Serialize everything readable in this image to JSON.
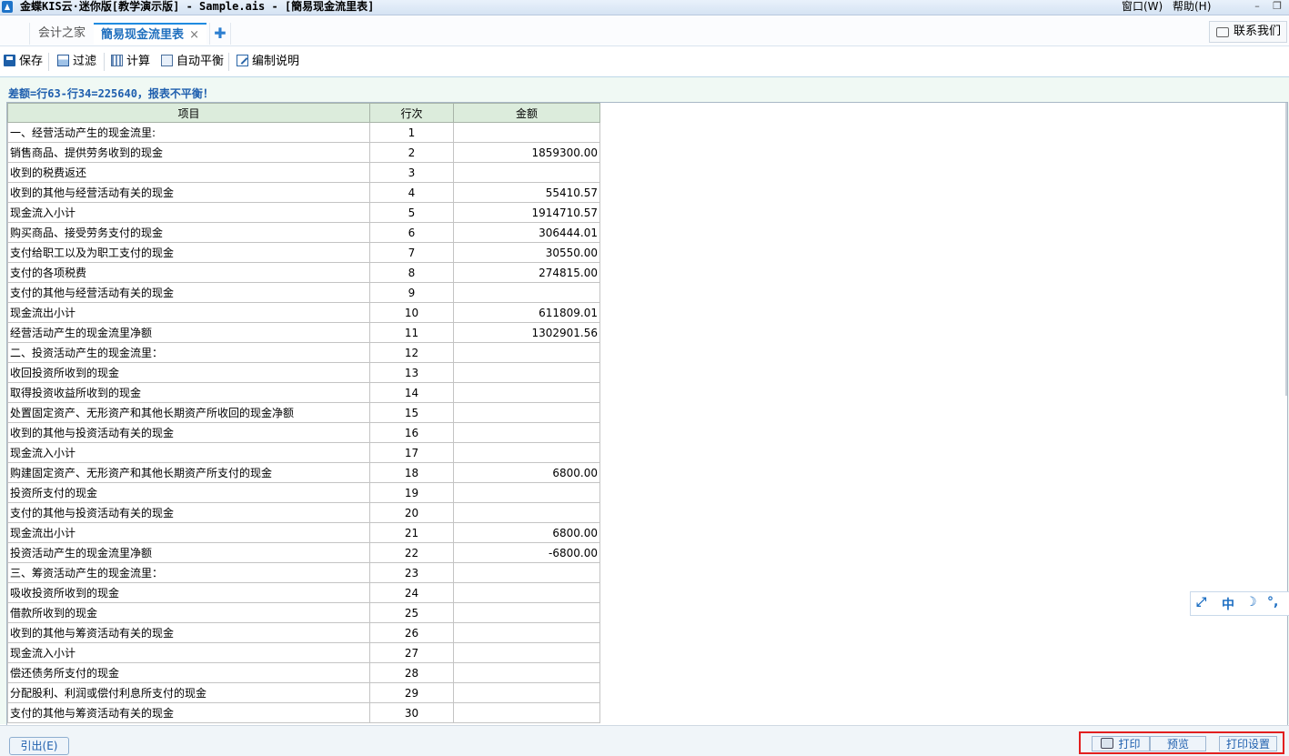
{
  "window": {
    "title": "金蝶KIS云·迷你版[教学演示版] - Sample.ais - [簡易现金流里表]",
    "menu_window": "窗口(W)",
    "menu_help": "帮助(H)"
  },
  "tabs": {
    "home": "会计之家",
    "active": "簡易现金流里表",
    "close_symbol": "×",
    "add_symbol": "✚"
  },
  "contact": "联系我们",
  "toolbar": {
    "save": "保存",
    "filter": "过滤",
    "calc": "计算",
    "auto_balance": "自动平衡",
    "edit_note": "编制说明"
  },
  "warning": "差额=行63-行34=225640，报表不平衡！",
  "table": {
    "headers": [
      "项目",
      "行次",
      "金额"
    ],
    "rows": [
      {
        "name": "一、经营活动产生的现金流里:",
        "row": "1",
        "amount": ""
      },
      {
        "name": "销售商品、提供劳务收到的现金",
        "row": "2",
        "amount": "1859300.00"
      },
      {
        "name": "收到的税费返还",
        "row": "3",
        "amount": ""
      },
      {
        "name": "收到的其他与经营活动有关的现金",
        "row": "4",
        "amount": "55410.57"
      },
      {
        "name": "现金流入小计",
        "row": "5",
        "amount": "1914710.57"
      },
      {
        "name": "购买商品、接受劳务支付的现金",
        "row": "6",
        "amount": "306444.01"
      },
      {
        "name": "支付给职工以及为职工支付的现金",
        "row": "7",
        "amount": "30550.00"
      },
      {
        "name": "支付的各项税费",
        "row": "8",
        "amount": "274815.00"
      },
      {
        "name": "支付的其他与经营活动有关的现金",
        "row": "9",
        "amount": ""
      },
      {
        "name": "现金流出小计",
        "row": "10",
        "amount": "611809.01"
      },
      {
        "name": "经营活动产生的现金流里净额",
        "row": "11",
        "amount": "1302901.56"
      },
      {
        "name": "二、投资活动产生的现金流里：",
        "row": "12",
        "amount": ""
      },
      {
        "name": "收回投资所收到的现金",
        "row": "13",
        "amount": ""
      },
      {
        "name": "取得投资收益所收到的现金",
        "row": "14",
        "amount": ""
      },
      {
        "name": "处置固定资产、无形资产和其他长期资产所收回的现金净额",
        "row": "15",
        "amount": ""
      },
      {
        "name": "收到的其他与投资活动有关的现金",
        "row": "16",
        "amount": ""
      },
      {
        "name": "现金流入小计",
        "row": "17",
        "amount": ""
      },
      {
        "name": "购建固定资产、无形资产和其他长期资产所支付的现金",
        "row": "18",
        "amount": "6800.00"
      },
      {
        "name": "投资所支付的现金",
        "row": "19",
        "amount": ""
      },
      {
        "name": "支付的其他与投资活动有关的现金",
        "row": "20",
        "amount": ""
      },
      {
        "name": "现金流出小计",
        "row": "21",
        "amount": "6800.00"
      },
      {
        "name": "投资活动产生的现金流里净额",
        "row": "22",
        "amount": "-6800.00"
      },
      {
        "name": "三、筹资活动产生的现金流里：",
        "row": "23",
        "amount": ""
      },
      {
        "name": "吸收投资所收到的现金",
        "row": "24",
        "amount": ""
      },
      {
        "name": "借款所收到的现金",
        "row": "25",
        "amount": ""
      },
      {
        "name": "收到的其他与筹资活动有关的现金",
        "row": "26",
        "amount": ""
      },
      {
        "name": "现金流入小计",
        "row": "27",
        "amount": ""
      },
      {
        "name": "偿还债务所支付的现金",
        "row": "28",
        "amount": ""
      },
      {
        "name": "分配股利、利润或偿付利息所支付的现金",
        "row": "29",
        "amount": ""
      },
      {
        "name": "支付的其他与筹资活动有关的现金",
        "row": "30",
        "amount": ""
      }
    ]
  },
  "ime": {
    "mode": "中",
    "moon": "☽",
    "dots": "°,",
    "arrow": "⤢"
  },
  "bottom": {
    "export": "引出(E)",
    "print": "打印",
    "preview": "预览",
    "print_setup": "打印设置"
  },
  "colors": {
    "accent": "#1f6fbe",
    "warning_text": "#1f5fae",
    "header_bg": "#dcecdc",
    "highlight_border": "#e21f1f"
  }
}
